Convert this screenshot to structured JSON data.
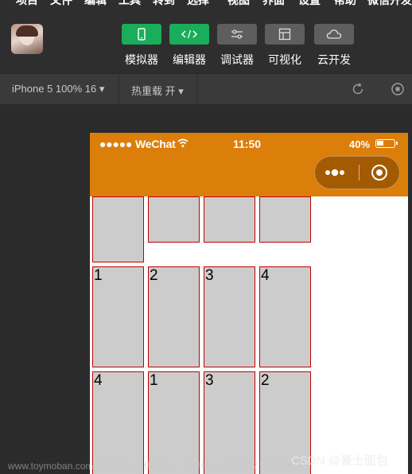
{
  "menu": [
    "项目",
    "文件",
    "编辑",
    "工具",
    "转到",
    "选择",
    "视图",
    "界面",
    "设置",
    "帮助",
    "微信开发者工具"
  ],
  "toolbar": {
    "buttons": [
      {
        "label": "模拟器",
        "color": "#1aad5b"
      },
      {
        "label": "编辑器",
        "color": "#1aad5b"
      },
      {
        "label": "调试器",
        "color": "#5e5e5e"
      },
      {
        "label": "可视化",
        "color": "#5e5e5e"
      },
      {
        "label": "云开发",
        "color": "#5e5e5e"
      }
    ]
  },
  "subbar": {
    "device": "iPhone 5 100% 16 ▾",
    "reload": "热重载 开 ▾"
  },
  "phone": {
    "carrier": "●●●●● WeChat",
    "time": "11:50",
    "battery": "40%",
    "nav_color": "#dc7e0a"
  },
  "grid": {
    "top_row": [
      "",
      "",
      "",
      ""
    ],
    "row2": [
      "1",
      "2",
      "3",
      "4"
    ],
    "row3": [
      "4",
      "1",
      "3",
      "2"
    ]
  },
  "watermark": "www.toymoban.com 网络图片仅供展示，非存储，如有侵权请联系删除。",
  "credit": "CSDN @豪士面包"
}
